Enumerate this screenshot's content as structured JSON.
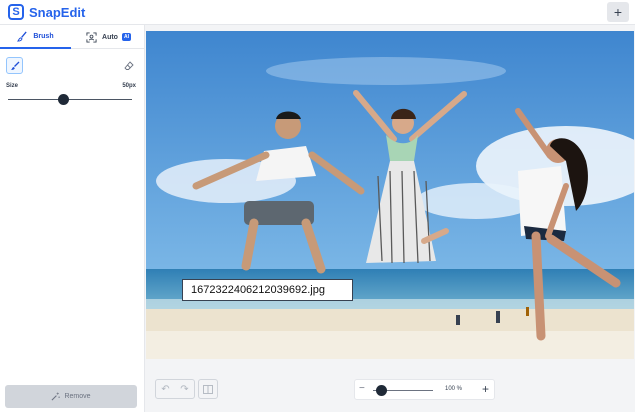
{
  "app": {
    "name": "SnapEdit",
    "logo_letter": "S",
    "new_button": "+"
  },
  "sidebar": {
    "tabs": [
      {
        "label": "Brush",
        "icon": "brush-icon",
        "active": true
      },
      {
        "label": "Auto",
        "icon": "auto-select-icon",
        "badge": "AI"
      }
    ],
    "size_label": "Size",
    "size_value": "50px",
    "brush_size_fraction": 0.45,
    "remove_label": "Remove"
  },
  "canvas": {
    "filename_tooltip": "16723224062120396​92.jpg"
  },
  "zoom": {
    "value": "100 %",
    "minus": "−",
    "plus": "+"
  },
  "colors": {
    "brand": "#2563eb",
    "sky": "#5d9fdb",
    "sand": "#ece3cf"
  }
}
